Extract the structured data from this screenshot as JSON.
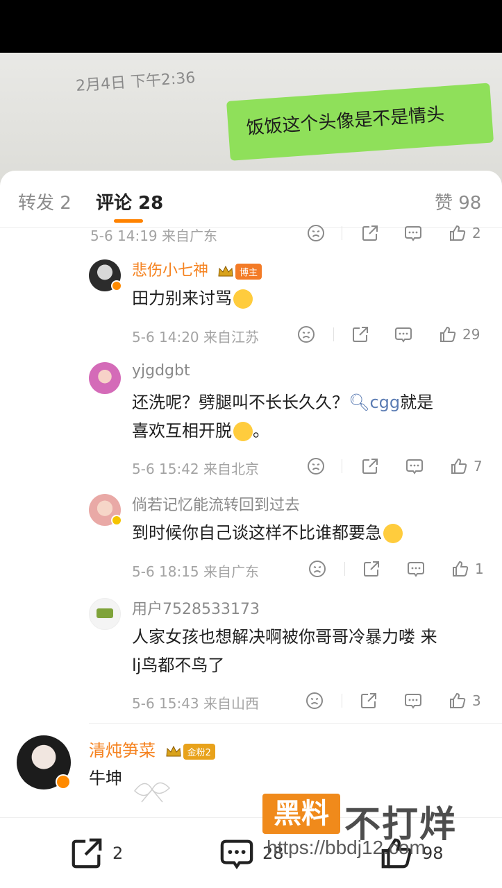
{
  "photo": {
    "timestamp": "2月4日 下午2:36",
    "bubble_text": "饭饭这个头像是不是情头"
  },
  "tabs": [
    {
      "label": "转发 2",
      "active": false
    },
    {
      "label": "评论 28",
      "active": true
    },
    {
      "label": "赞 98",
      "active": false
    }
  ],
  "accent_color": "#ff8200",
  "top_meta": {
    "time_loc": "5-6 14:19 来自广东",
    "like_count": "2"
  },
  "replies": [
    {
      "name": "悲伤小七神",
      "badge": "博主",
      "text": "田力别来讨骂",
      "emoji": "shush-emoji",
      "time_loc": "5-6 14:20 来自江苏",
      "like_count": "29"
    },
    {
      "name": "yjgdgbt",
      "text_before": "还洗呢？劈腿叫不长长久久？",
      "link": "cgg",
      "text_after": "就是",
      "text_line2": "喜欢互相开脱",
      "text_line2_end": "。",
      "emoji": "smile-emoji",
      "time_loc": "5-6 15:42 来自北京",
      "like_count": "7"
    },
    {
      "name": "倘若记忆能流转回到过去",
      "text": "到时候你自己谈这样不比谁都要急",
      "emoji": "crying-emoji",
      "time_loc": "5-6 18:15 来自广东",
      "like_count": "1"
    },
    {
      "name": "用户7528533173",
      "text_line1": "人家女孩也想解决啊被你哥哥冷暴力喽 来",
      "text_line2": "lj鸟都不鸟了",
      "time_loc": "5-6 15:43 来自山西",
      "like_count": "3"
    }
  ],
  "main_comment": {
    "name": "清炖笋菜",
    "badge": "金粉2",
    "text": "牛坤"
  },
  "bottom_bar": {
    "repost_count": "2",
    "comment_count": "28",
    "like_count": "98"
  },
  "watermark": {
    "box_text": "黑料",
    "text": "不打烊",
    "url": "https://bbdj12.com"
  }
}
